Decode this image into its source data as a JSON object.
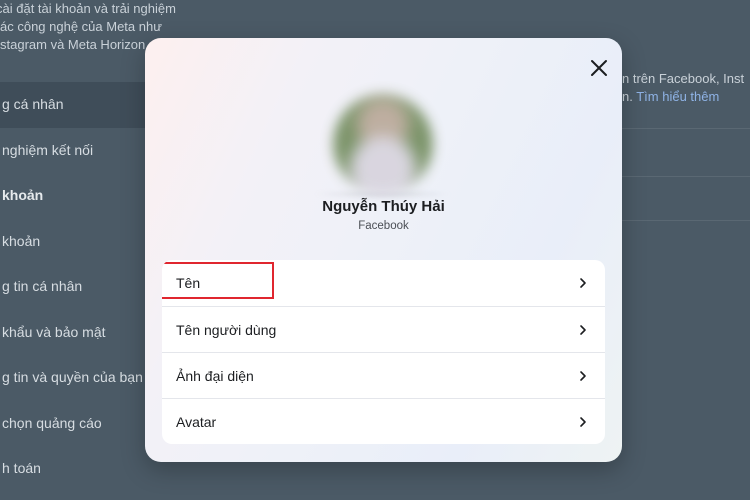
{
  "background": {
    "description_lines": [
      "cài đặt tài khoản và trải nghiệm",
      "ác công nghệ của Meta như",
      "stagram và Meta Horizon"
    ],
    "menu": [
      {
        "label": "g cá nhân",
        "active": true,
        "section": false
      },
      {
        "label": "nghiệm kết nối",
        "active": false,
        "section": false
      },
      {
        "label": "khoản",
        "active": false,
        "section": true
      },
      {
        "label": "khoản",
        "active": false,
        "section": false
      },
      {
        "label": "g tin cá nhân",
        "active": false,
        "section": false
      },
      {
        "label": "khẩu và bảo mật",
        "active": false,
        "section": false
      },
      {
        "label": "g tin và quyền của bạn",
        "active": false,
        "section": false
      },
      {
        "label": "chọn quảng cáo",
        "active": false,
        "section": false
      },
      {
        "label": "h toán",
        "active": false,
        "section": false
      }
    ],
    "right_text_line1": "n trên Facebook, Inst",
    "right_text_line2": "n.",
    "right_link": "Tìm hiểu thêm"
  },
  "modal": {
    "close_icon": "close-icon",
    "profile": {
      "name": "Nguyễn Thúy Hải",
      "platform": "Facebook"
    },
    "items": [
      {
        "label": "Tên",
        "icon": "chevron-right-icon",
        "highlighted": true
      },
      {
        "label": "Tên người dùng",
        "icon": "chevron-right-icon",
        "highlighted": false
      },
      {
        "label": "Ảnh đại diện",
        "icon": "chevron-right-icon",
        "highlighted": false
      },
      {
        "label": "Avatar",
        "icon": "chevron-right-icon",
        "highlighted": false
      }
    ]
  },
  "colors": {
    "overlay_background": "#4b5a66",
    "highlight": "#e0262f",
    "link": "#8fb3e6"
  }
}
